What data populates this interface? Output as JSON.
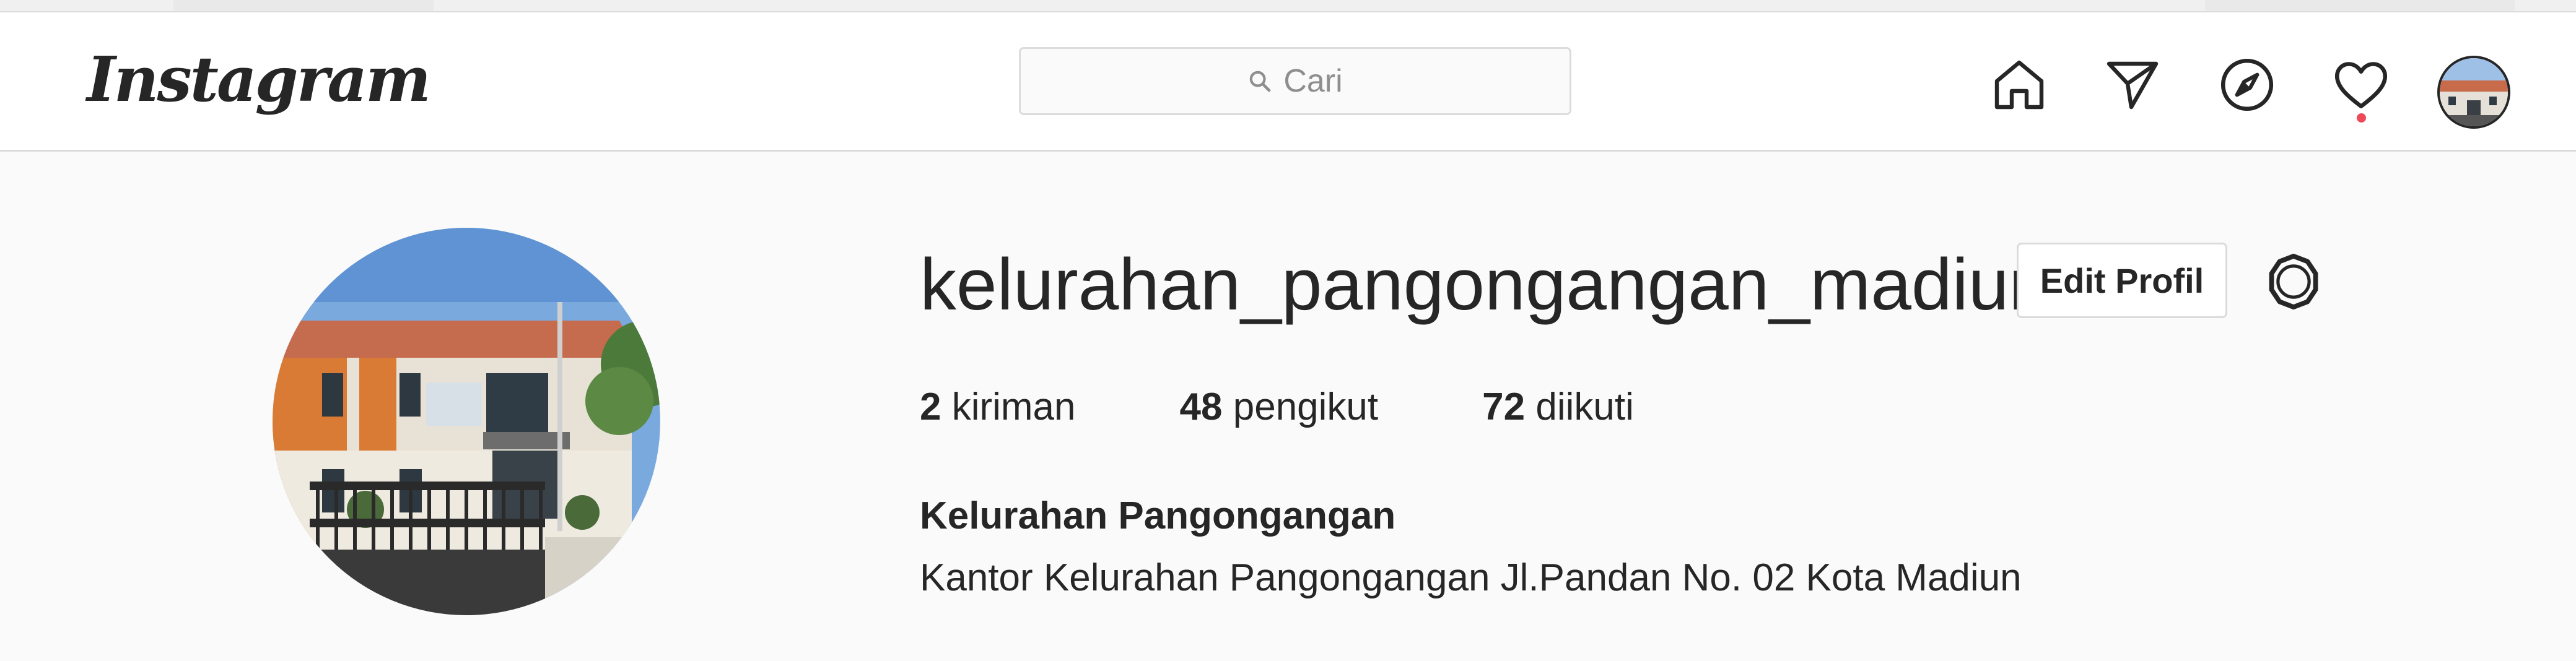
{
  "app": {
    "logo_text": "Instagram"
  },
  "search": {
    "placeholder": "Cari"
  },
  "nav": {
    "icons": [
      "home-icon",
      "direct-message-icon",
      "explore-compass-icon",
      "activity-heart-icon",
      "profile-avatar"
    ],
    "notification_color": "#ed4956"
  },
  "profile": {
    "username": "kelurahan_pangongangan_madiun",
    "edit_button_label": "Edit Profil",
    "stats": {
      "posts_count": "2",
      "posts_label": "kiriman",
      "followers_count": "48",
      "followers_label": "pengikut",
      "following_count": "72",
      "following_label": "diikuti"
    },
    "full_name": "Kelurahan Pangongangan",
    "bio": "Kantor Kelurahan Pangongangan Jl.Pandan No. 02 Kota Madiun"
  }
}
